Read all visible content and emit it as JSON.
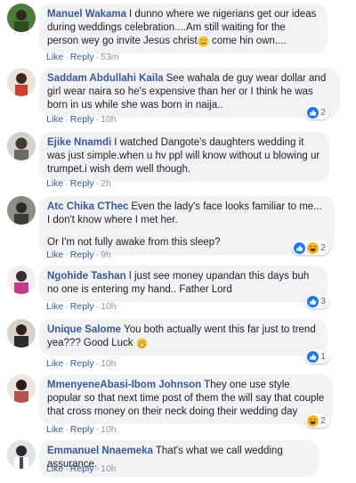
{
  "comments": [
    {
      "name": "Manuel Wakama",
      "text_lines": [
        "I dunno where we nigerians get our ideas during weddings celebration....Am still waiting for the person wey go invite Jesus christ"
      ],
      "text_after_emoji": " come hin own....",
      "emoji": "smiling-sweat-emoji",
      "like": "Like",
      "reply": "Reply",
      "time": "53m",
      "reaction_count": "",
      "reaction_icons": []
    },
    {
      "name": "Saddam Abdullahi Kaila",
      "text_lines": [
        "See wahala de guy wear dollar and girl wear naira so he's expensive than her or I think he was born in us while she was born in naija.."
      ],
      "like": "Like",
      "reply": "Reply",
      "time": "10h",
      "reaction_count": "2",
      "reaction_icons": [
        "like-icon"
      ]
    },
    {
      "name": "Ejike Nnamdi",
      "text_lines": [
        "I watched Dangote's daughters wedding it was just simple.when u hv ppl will know without u blowing ur trumpet.i wish dem well though."
      ],
      "like": "Like",
      "reply": "Reply",
      "time": "2h",
      "reaction_count": "",
      "reaction_icons": []
    },
    {
      "name": "Atc Chika CThec",
      "text_lines": [
        "Even the lady's face looks familiar to me... I don't know where I met her.",
        "Or I'm not fully awake from this sleep?"
      ],
      "like": "Like",
      "reply": "Reply",
      "time": "9h",
      "reaction_count": "2",
      "reaction_icons": [
        "like-icon",
        "haha-icon"
      ]
    },
    {
      "name": "Ngohide Tashan",
      "text_lines": [
        "I just see money upandan this days buh no one is entering my hand.. Father Lord"
      ],
      "like": "Like",
      "reply": "Reply",
      "time": "10h",
      "reaction_count": "3",
      "reaction_icons": [
        "like-icon"
      ]
    },
    {
      "name": "Unique Salome",
      "text_lines": [
        "You both actually went this far just to trend yea??? Good Luck"
      ],
      "emoji": "grinning-sweat-emoji",
      "like": "Like",
      "reply": "Reply",
      "time": "10h",
      "reaction_count": "1",
      "reaction_icons": [
        "like-icon"
      ]
    },
    {
      "name": "MmenyeneAbasi-Ibom Johnson",
      "text_lines": [
        "They one use style popular so that next time post of them the will say that couple that cross money on their neck doing their wedding day"
      ],
      "like": "Like",
      "reply": "Reply",
      "time": "10h",
      "reaction_count": "2",
      "reaction_icons": [
        "haha-icon"
      ]
    },
    {
      "name": "Emmanuel Nnaemeka",
      "text_lines": [
        "That's what we call wedding assurance."
      ],
      "like": "Like",
      "reply": "Reply",
      "time": "10h",
      "reaction_count": "",
      "reaction_icons": []
    }
  ],
  "colors": {
    "link": "#385898",
    "bubble": "#f2f3f5",
    "meta": "#90949c",
    "like_blue": "#1877f2",
    "haha_yellow": "#f7b125"
  }
}
